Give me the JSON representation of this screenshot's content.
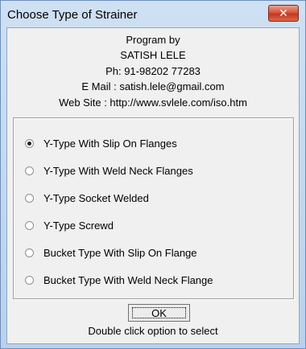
{
  "window": {
    "title": "Choose Type of Strainer",
    "close_label": "✕"
  },
  "info": {
    "line1": "Program by",
    "line2": "SATISH LELE",
    "line3": "Ph: 91-98202 77283",
    "line4": "E Mail : satish.lele@gmail.com",
    "line5": "Web Site : http://www.svlele.com/iso.htm"
  },
  "options": [
    {
      "label": "Y-Type With Slip On Flanges",
      "selected": true
    },
    {
      "label": "Y-Type With Weld Neck Flanges",
      "selected": false
    },
    {
      "label": "Y-Type Socket Welded",
      "selected": false
    },
    {
      "label": "Y-Type Screwd",
      "selected": false
    },
    {
      "label": "Bucket Type With Slip On Flange",
      "selected": false
    },
    {
      "label": "Bucket Type With Weld Neck Flange",
      "selected": false
    }
  ],
  "ok_label": "OK",
  "hint": "Double click option to select",
  "colors": {
    "close_button": "#d04a30",
    "dialog_background": "#f0f0f0",
    "titlebar": "#c5daf1"
  }
}
